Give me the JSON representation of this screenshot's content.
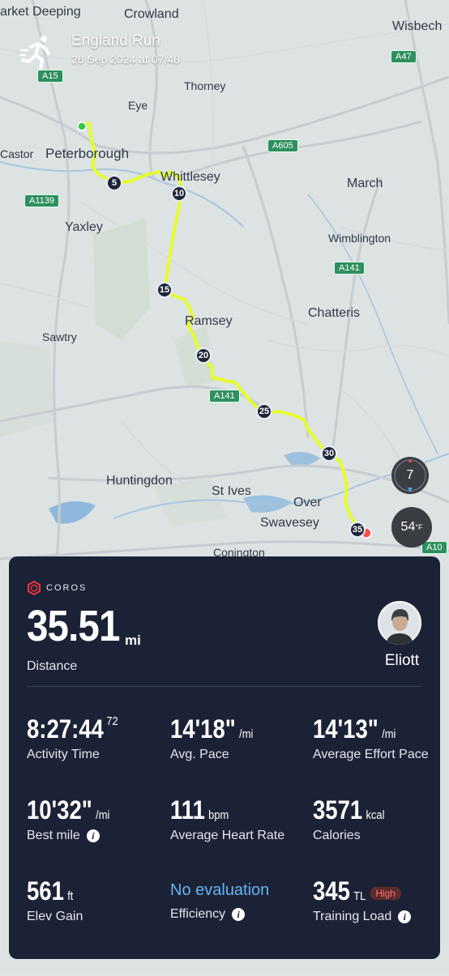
{
  "activity": {
    "title": "England Run",
    "datetime": "26 Sep 2024 at 07:48"
  },
  "map": {
    "places": {
      "market_deeping": "arket Deeping",
      "crowland": "Crowland",
      "wisbech": "Wisbech",
      "thorney": "Thorney",
      "eye": "Eye",
      "castor": "Castor",
      "peterborough": "Peterborough",
      "whittlesey": "Whittlesey",
      "march": "March",
      "yaxley": "Yaxley",
      "wimblington": "Wimblington",
      "chatteris": "Chatteris",
      "sawtry": "Sawtry",
      "ramsey": "Ramsey",
      "huntingdon": "Huntingdon",
      "st_ives": "St Ives",
      "over": "Over",
      "swavesey": "Swavesey",
      "conington": "Conington"
    },
    "roads": {
      "a15": "A15",
      "a47": "A47",
      "a605": "A605",
      "a1139": "A1139",
      "a141_north": "A141",
      "a141_south": "A141",
      "a10": "A10"
    },
    "mile_markers": [
      "5",
      "10",
      "15",
      "20",
      "25",
      "30",
      "35"
    ],
    "compass_value": "7",
    "temperature": {
      "value": "54",
      "unit": "°F"
    },
    "route_color": "#e4ff2c",
    "start_color": "#2ecc40",
    "end_color": "#ff4a4a"
  },
  "card": {
    "brand": "COROS",
    "distance": {
      "value": "35.51",
      "unit": "mi",
      "label": "Distance"
    },
    "user": {
      "name": "Eliott"
    },
    "stats": {
      "activity_time": {
        "value": "8:27:44",
        "fraction": "72",
        "label": "Activity Time"
      },
      "avg_pace": {
        "value": "14'18\"",
        "unit": "/mi",
        "label": "Avg. Pace"
      },
      "effort_pace": {
        "value": "14'13\"",
        "unit": "/mi",
        "label": "Average Effort Pace"
      },
      "best_mile": {
        "value": "10'32\"",
        "unit": "/mi",
        "label": "Best mile"
      },
      "heart_rate": {
        "value": "111",
        "unit": "bpm",
        "label": "Average Heart Rate"
      },
      "calories": {
        "value": "3571",
        "unit": "kcal",
        "label": "Calories"
      },
      "elev_gain": {
        "value": "561",
        "unit": "ft",
        "label": "Elev Gain"
      },
      "efficiency": {
        "value": "No evaluation",
        "label": "Efficiency"
      },
      "training_load": {
        "value": "345",
        "unit": "TL",
        "badge": "High",
        "label": "Training Load"
      }
    }
  }
}
